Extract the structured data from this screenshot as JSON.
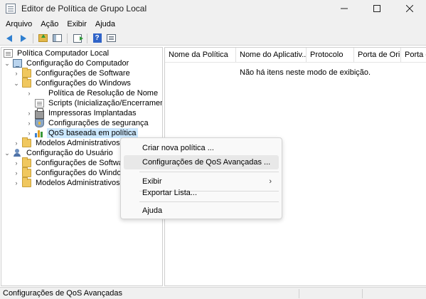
{
  "window": {
    "title": "Editor de Política de Grupo Local"
  },
  "menubar": [
    "Arquivo",
    "Ação",
    "Exibir",
    "Ajuda"
  ],
  "tree": {
    "root": "Política Computador Local",
    "computer": "Configuração do Computador",
    "computer_children": {
      "software": "Configurações de Software",
      "windows": "Configurações do Windows",
      "windows_children": {
        "name_resolution": "Política de Resolução de Nome",
        "scripts": "Scripts (Inicialização/Encerramento)",
        "printers": "Impressoras Implantadas",
        "security": "Configurações de segurança",
        "qos": "QoS baseada em política"
      },
      "admin_templates": "Modelos Administrativos"
    },
    "user": "Configuração do Usuário",
    "user_children": {
      "software": "Configurações de Software",
      "windows": "Configurações do Windows",
      "admin_templates": "Modelos Administrativos"
    }
  },
  "list": {
    "columns": [
      "Nome da Política",
      "Nome do Aplicativ...",
      "Protocolo",
      "Porta de Ori...",
      "Porta de"
    ],
    "empty_message": "Não há itens neste modo de exibição."
  },
  "context_menu": {
    "items": {
      "create": "Criar nova política ...",
      "advanced": "Configurações de QoS Avançadas ...",
      "view": "Exibir",
      "export": "Exportar Lista...",
      "help": "Ajuda"
    }
  },
  "statusbar": {
    "text": "Configurações de QoS Avançadas"
  }
}
